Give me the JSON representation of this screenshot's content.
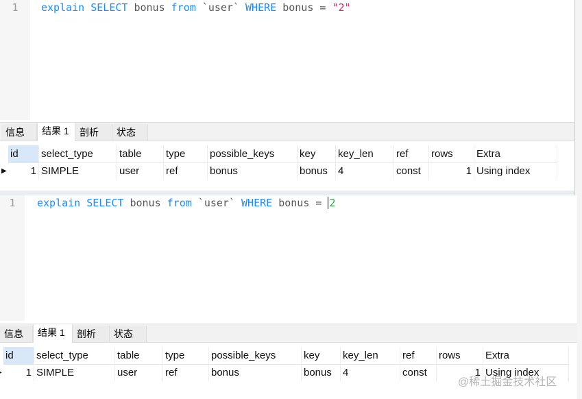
{
  "panels": [
    {
      "line": "1",
      "code": {
        "explain": "explain",
        "select": "SELECT",
        "col": " bonus ",
        "from": "from",
        "tbl": " `user` ",
        "where": "WHERE",
        "cond": " bonus = ",
        "value": "\"2\""
      },
      "tabs": [
        "信息",
        "结果 1",
        "剖析",
        "状态"
      ],
      "active_tab": 1,
      "columns": [
        "id",
        "select_type",
        "table",
        "type",
        "possible_keys",
        "key",
        "key_len",
        "ref",
        "rows",
        "Extra"
      ],
      "rows": [
        [
          "1",
          "SIMPLE",
          "user",
          "ref",
          "bonus",
          "bonus",
          "4",
          "const",
          "1",
          "Using index"
        ]
      ]
    },
    {
      "line": "1",
      "code": {
        "explain": "explain",
        "select": "SELECT",
        "col": " bonus ",
        "from": "from",
        "tbl": " `user` ",
        "where": "WHERE",
        "cond": " bonus = ",
        "value": "2"
      },
      "tabs": [
        "信息",
        "结果 1",
        "剖析",
        "状态"
      ],
      "active_tab": 1,
      "columns": [
        "id",
        "select_type",
        "table",
        "type",
        "possible_keys",
        "key",
        "key_len",
        "ref",
        "rows",
        "Extra"
      ],
      "rows": [
        [
          "1",
          "SIMPLE",
          "user",
          "ref",
          "bonus",
          "bonus",
          "4",
          "const",
          "1",
          "Using index"
        ]
      ]
    }
  ],
  "watermark": "@稀土掘金技术社区",
  "colors": {
    "keyword": "#1a8cff",
    "string": "#e0245e",
    "number": "#22aa44"
  }
}
